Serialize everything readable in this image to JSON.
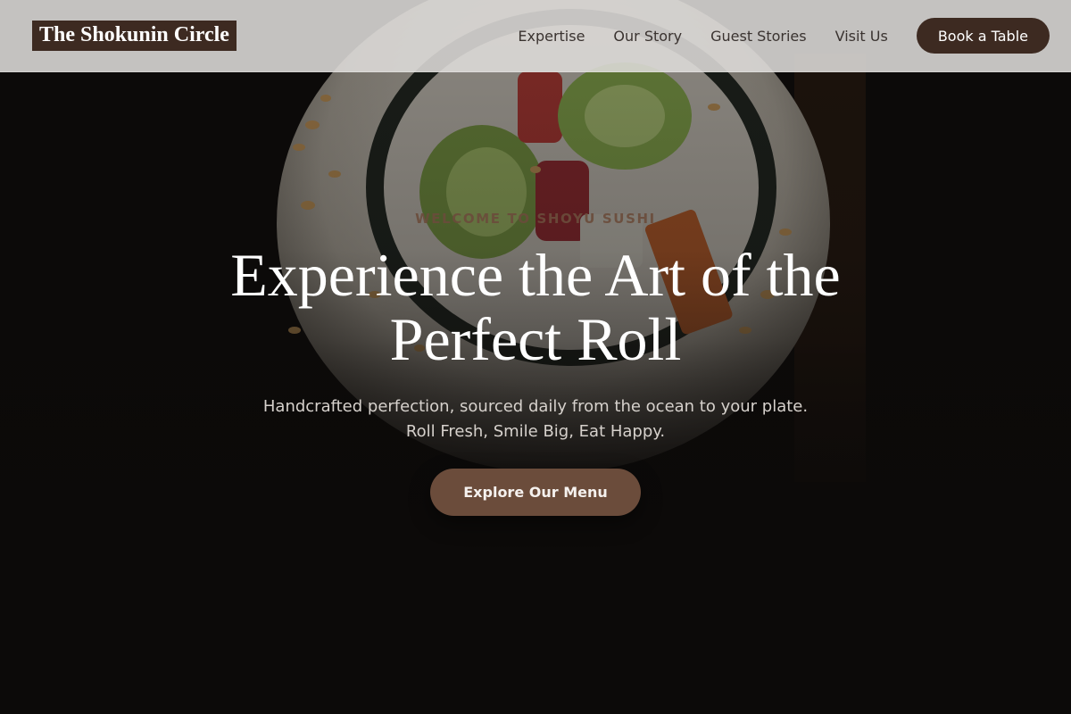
{
  "header": {
    "brand": "The Shokunin Circle",
    "nav": [
      {
        "label": "Expertise"
      },
      {
        "label": "Our Story"
      },
      {
        "label": "Guest Stories"
      },
      {
        "label": "Visit Us"
      }
    ],
    "cta_label": "Book a Table"
  },
  "hero": {
    "eyebrow": "WELCOME TO SHOYU SUSHI",
    "title_line1": "Experience the Art of the",
    "title_line2": "Perfect Roll",
    "subtitle_line1": "Handcrafted perfection, sourced daily from the ocean to your plate.",
    "subtitle_line2": "Roll Fresh, Smile Big, Eat Happy.",
    "button_label": "Explore Our Menu",
    "background_image": "sushi-roll-photo"
  },
  "colors": {
    "brand_dark": "#3d2a21",
    "accent": "#6b4c3b",
    "page_background": "#0c0a09",
    "header_background": "#dedcda"
  }
}
